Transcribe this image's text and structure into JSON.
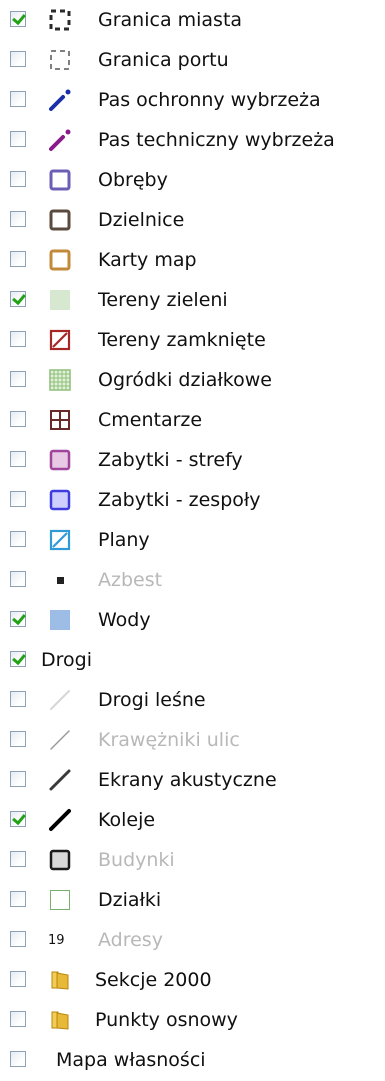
{
  "layers": [
    {
      "label": "Granica miasta",
      "checked": true,
      "muted": false,
      "icon": "dashed-square-bold-icon"
    },
    {
      "label": "Granica portu",
      "checked": false,
      "muted": false,
      "icon": "dashed-square-light-icon"
    },
    {
      "label": "Pas ochronny wybrzeża",
      "checked": false,
      "muted": false,
      "icon": "blue-dashed-line-icon",
      "color": "#1b2fa8"
    },
    {
      "label": "Pas techniczny wybrzeża",
      "checked": false,
      "muted": false,
      "icon": "purple-dashed-line-icon",
      "color": "#8a1a8a"
    },
    {
      "label": "Obręby",
      "checked": false,
      "muted": false,
      "icon": "outlined-square-icon",
      "color": "#6b5fb5"
    },
    {
      "label": "Dzielnice",
      "checked": false,
      "muted": false,
      "icon": "outlined-square-icon",
      "color": "#5a4a3e"
    },
    {
      "label": "Karty map",
      "checked": false,
      "muted": false,
      "icon": "outlined-square-icon",
      "color": "#c08a3a"
    },
    {
      "label": "Tereny zieleni",
      "checked": true,
      "muted": false,
      "icon": "filled-square-icon",
      "color": "#d6e8cf"
    },
    {
      "label": "Tereny zamknięte",
      "checked": false,
      "muted": false,
      "icon": "hatched-square-icon",
      "color": "#a62626"
    },
    {
      "label": "Ogródki działkowe",
      "checked": false,
      "muted": false,
      "icon": "grid-square-icon",
      "color": "#8fbf7a"
    },
    {
      "label": "Cmentarze",
      "checked": false,
      "muted": false,
      "icon": "cross-square-icon",
      "color": "#6a2a2a"
    },
    {
      "label": "Zabytki - strefy",
      "checked": false,
      "muted": false,
      "icon": "filled-outlined-square-icon",
      "color": "#a0449b",
      "fill": "#e7c9e5"
    },
    {
      "label": "Zabytki - zespoły",
      "checked": false,
      "muted": false,
      "icon": "filled-outlined-square-icon",
      "color": "#3c3ce0",
      "fill": "#cfcfff"
    },
    {
      "label": "Plany",
      "checked": false,
      "muted": false,
      "icon": "hatched-square-icon",
      "color": "#2f9ad6"
    },
    {
      "label": "Azbest",
      "checked": false,
      "muted": true,
      "icon": "small-black-square-icon",
      "color": "#222222"
    },
    {
      "label": "Wody",
      "checked": true,
      "muted": false,
      "icon": "filled-square-icon",
      "color": "#9dbde6"
    },
    {
      "label": "Drogi",
      "checked": true,
      "muted": false,
      "icon": "none"
    },
    {
      "label": "Drogi leśne",
      "checked": false,
      "muted": false,
      "icon": "diagonal-line-icon",
      "color": "#d6d6d6",
      "width": 2
    },
    {
      "label": "Krawężniki ulic",
      "checked": false,
      "muted": true,
      "icon": "diagonal-line-icon",
      "color": "#9a9a9a",
      "width": 1.5
    },
    {
      "label": "Ekrany akustyczne",
      "checked": false,
      "muted": false,
      "icon": "diagonal-line-icon",
      "color": "#3a3a3a",
      "width": 3
    },
    {
      "label": "Koleje",
      "checked": true,
      "muted": false,
      "icon": "diagonal-line-icon",
      "color": "#000000",
      "width": 4
    },
    {
      "label": "Budynki",
      "checked": false,
      "muted": true,
      "icon": "filled-outlined-square-icon",
      "color": "#1a1a1a",
      "fill": "#d8d8d8"
    },
    {
      "label": "Działki",
      "checked": false,
      "muted": false,
      "icon": "outlined-square-thin-icon",
      "color": "#7ab06a"
    },
    {
      "label": "Adresy",
      "checked": false,
      "muted": true,
      "icon": "number-icon",
      "icon_text": "19"
    },
    {
      "label": "Sekcje 2000",
      "checked": false,
      "muted": false,
      "icon": "folder-icon",
      "color": "#e8b838"
    },
    {
      "label": "Punkty osnowy",
      "checked": false,
      "muted": false,
      "icon": "folder-icon",
      "color": "#e8b838"
    },
    {
      "label": "Mapa własności",
      "checked": false,
      "muted": false,
      "icon": "none"
    }
  ]
}
